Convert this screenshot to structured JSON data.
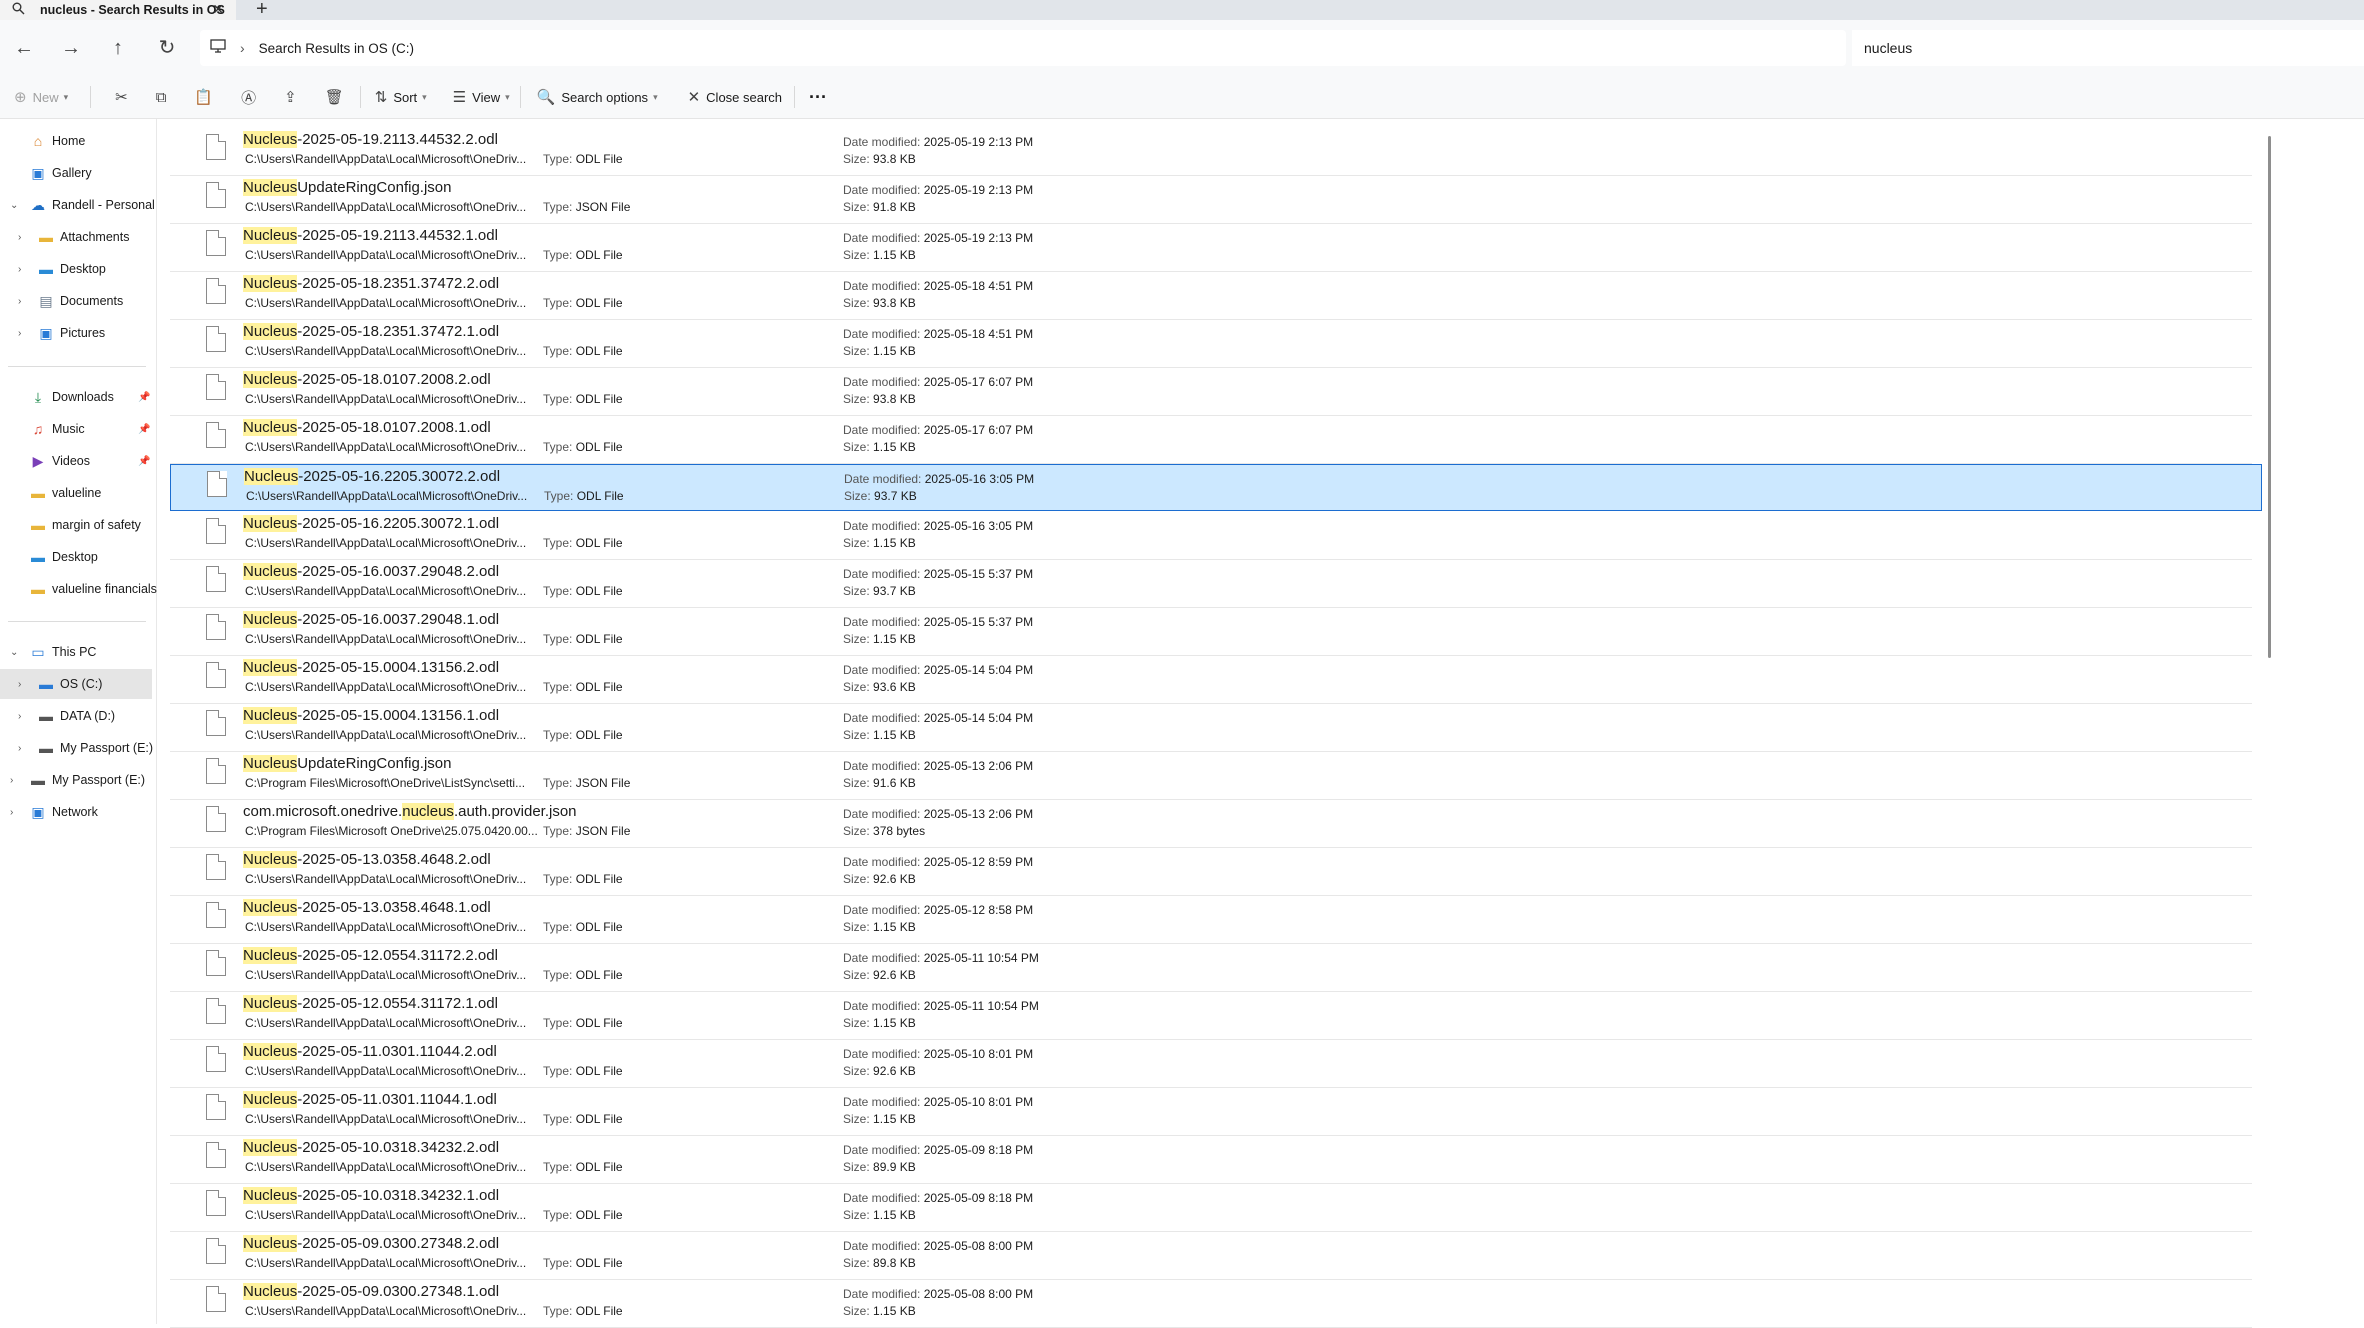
{
  "tab": {
    "title": "nucleus - Search Results in OS",
    "close": "✕",
    "new": "+"
  },
  "address": {
    "path": "Search Results in OS (C:)"
  },
  "search": {
    "value": "nucleus"
  },
  "commands": {
    "new": "New",
    "sort": "Sort",
    "view": "View",
    "search_options": "Search options",
    "close_search": "Close search",
    "more": "···"
  },
  "sidebar": {
    "items": [
      {
        "label": "Home"
      },
      {
        "label": "Gallery"
      },
      {
        "label": "Randell - Personal"
      },
      {
        "label": "Attachments"
      },
      {
        "label": "Desktop"
      },
      {
        "label": "Documents"
      },
      {
        "label": "Pictures"
      },
      {
        "label": "Downloads"
      },
      {
        "label": "Music"
      },
      {
        "label": "Videos"
      },
      {
        "label": "valueline"
      },
      {
        "label": "margin of safety"
      },
      {
        "label": "Desktop"
      },
      {
        "label": "valueline financials"
      },
      {
        "label": "This PC"
      },
      {
        "label": "OS (C:)"
      },
      {
        "label": "DATA (D:)"
      },
      {
        "label": "My Passport (E:)"
      },
      {
        "label": "My Passport (E:)"
      },
      {
        "label": "Network"
      }
    ]
  },
  "labels": {
    "type": "Type:",
    "date": "Date modified:",
    "size": "Size:"
  },
  "files": [
    {
      "pre": "",
      "hl": "Nucleus",
      "post": "-2025-05-19.2113.44532.2.odl",
      "path": "C:\\Users\\Randell\\AppData\\Local\\Microsoft\\OneDriv...",
      "type": "ODL File",
      "date": "2025-05-19 2:13 PM",
      "size": "93.8 KB"
    },
    {
      "pre": "",
      "hl": "Nucleus",
      "post": "UpdateRingConfig.json",
      "path": "C:\\Users\\Randell\\AppData\\Local\\Microsoft\\OneDriv...",
      "type": "JSON File",
      "date": "2025-05-19 2:13 PM",
      "size": "91.8 KB"
    },
    {
      "pre": "",
      "hl": "Nucleus",
      "post": "-2025-05-19.2113.44532.1.odl",
      "path": "C:\\Users\\Randell\\AppData\\Local\\Microsoft\\OneDriv...",
      "type": "ODL File",
      "date": "2025-05-19 2:13 PM",
      "size": "1.15 KB"
    },
    {
      "pre": "",
      "hl": "Nucleus",
      "post": "-2025-05-18.2351.37472.2.odl",
      "path": "C:\\Users\\Randell\\AppData\\Local\\Microsoft\\OneDriv...",
      "type": "ODL File",
      "date": "2025-05-18 4:51 PM",
      "size": "93.8 KB"
    },
    {
      "pre": "",
      "hl": "Nucleus",
      "post": "-2025-05-18.2351.37472.1.odl",
      "path": "C:\\Users\\Randell\\AppData\\Local\\Microsoft\\OneDriv...",
      "type": "ODL File",
      "date": "2025-05-18 4:51 PM",
      "size": "1.15 KB"
    },
    {
      "pre": "",
      "hl": "Nucleus",
      "post": "-2025-05-18.0107.2008.2.odl",
      "path": "C:\\Users\\Randell\\AppData\\Local\\Microsoft\\OneDriv...",
      "type": "ODL File",
      "date": "2025-05-17 6:07 PM",
      "size": "93.8 KB"
    },
    {
      "pre": "",
      "hl": "Nucleus",
      "post": "-2025-05-18.0107.2008.1.odl",
      "path": "C:\\Users\\Randell\\AppData\\Local\\Microsoft\\OneDriv...",
      "type": "ODL File",
      "date": "2025-05-17 6:07 PM",
      "size": "1.15 KB"
    },
    {
      "pre": "",
      "hl": "Nucleus",
      "post": "-2025-05-16.2205.30072.2.odl",
      "path": "C:\\Users\\Randell\\AppData\\Local\\Microsoft\\OneDriv...",
      "type": "ODL File",
      "date": "2025-05-16 3:05 PM",
      "size": "93.7 KB",
      "selected": true
    },
    {
      "pre": "",
      "hl": "Nucleus",
      "post": "-2025-05-16.2205.30072.1.odl",
      "path": "C:\\Users\\Randell\\AppData\\Local\\Microsoft\\OneDriv...",
      "type": "ODL File",
      "date": "2025-05-16 3:05 PM",
      "size": "1.15 KB"
    },
    {
      "pre": "",
      "hl": "Nucleus",
      "post": "-2025-05-16.0037.29048.2.odl",
      "path": "C:\\Users\\Randell\\AppData\\Local\\Microsoft\\OneDriv...",
      "type": "ODL File",
      "date": "2025-05-15 5:37 PM",
      "size": "93.7 KB"
    },
    {
      "pre": "",
      "hl": "Nucleus",
      "post": "-2025-05-16.0037.29048.1.odl",
      "path": "C:\\Users\\Randell\\AppData\\Local\\Microsoft\\OneDriv...",
      "type": "ODL File",
      "date": "2025-05-15 5:37 PM",
      "size": "1.15 KB"
    },
    {
      "pre": "",
      "hl": "Nucleus",
      "post": "-2025-05-15.0004.13156.2.odl",
      "path": "C:\\Users\\Randell\\AppData\\Local\\Microsoft\\OneDriv...",
      "type": "ODL File",
      "date": "2025-05-14 5:04 PM",
      "size": "93.6 KB"
    },
    {
      "pre": "",
      "hl": "Nucleus",
      "post": "-2025-05-15.0004.13156.1.odl",
      "path": "C:\\Users\\Randell\\AppData\\Local\\Microsoft\\OneDriv...",
      "type": "ODL File",
      "date": "2025-05-14 5:04 PM",
      "size": "1.15 KB"
    },
    {
      "pre": "",
      "hl": "Nucleus",
      "post": "UpdateRingConfig.json",
      "path": "C:\\Program Files\\Microsoft\\OneDrive\\ListSync\\setti...",
      "type": "JSON File",
      "date": "2025-05-13 2:06 PM",
      "size": "91.6 KB"
    },
    {
      "pre": "com.microsoft.onedrive.",
      "hl": "nucleus",
      "post": ".auth.provider.json",
      "path": "C:\\Program Files\\Microsoft OneDrive\\25.075.0420.00...",
      "type": "JSON File",
      "date": "2025-05-13 2:06 PM",
      "size": "378 bytes"
    },
    {
      "pre": "",
      "hl": "Nucleus",
      "post": "-2025-05-13.0358.4648.2.odl",
      "path": "C:\\Users\\Randell\\AppData\\Local\\Microsoft\\OneDriv...",
      "type": "ODL File",
      "date": "2025-05-12 8:59 PM",
      "size": "92.6 KB"
    },
    {
      "pre": "",
      "hl": "Nucleus",
      "post": "-2025-05-13.0358.4648.1.odl",
      "path": "C:\\Users\\Randell\\AppData\\Local\\Microsoft\\OneDriv...",
      "type": "ODL File",
      "date": "2025-05-12 8:58 PM",
      "size": "1.15 KB"
    },
    {
      "pre": "",
      "hl": "Nucleus",
      "post": "-2025-05-12.0554.31172.2.odl",
      "path": "C:\\Users\\Randell\\AppData\\Local\\Microsoft\\OneDriv...",
      "type": "ODL File",
      "date": "2025-05-11 10:54 PM",
      "size": "92.6 KB"
    },
    {
      "pre": "",
      "hl": "Nucleus",
      "post": "-2025-05-12.0554.31172.1.odl",
      "path": "C:\\Users\\Randell\\AppData\\Local\\Microsoft\\OneDriv...",
      "type": "ODL File",
      "date": "2025-05-11 10:54 PM",
      "size": "1.15 KB"
    },
    {
      "pre": "",
      "hl": "Nucleus",
      "post": "-2025-05-11.0301.11044.2.odl",
      "path": "C:\\Users\\Randell\\AppData\\Local\\Microsoft\\OneDriv...",
      "type": "ODL File",
      "date": "2025-05-10 8:01 PM",
      "size": "92.6 KB"
    },
    {
      "pre": "",
      "hl": "Nucleus",
      "post": "-2025-05-11.0301.11044.1.odl",
      "path": "C:\\Users\\Randell\\AppData\\Local\\Microsoft\\OneDriv...",
      "type": "ODL File",
      "date": "2025-05-10 8:01 PM",
      "size": "1.15 KB"
    },
    {
      "pre": "",
      "hl": "Nucleus",
      "post": "-2025-05-10.0318.34232.2.odl",
      "path": "C:\\Users\\Randell\\AppData\\Local\\Microsoft\\OneDriv...",
      "type": "ODL File",
      "date": "2025-05-09 8:18 PM",
      "size": "89.9 KB"
    },
    {
      "pre": "",
      "hl": "Nucleus",
      "post": "-2025-05-10.0318.34232.1.odl",
      "path": "C:\\Users\\Randell\\AppData\\Local\\Microsoft\\OneDriv...",
      "type": "ODL File",
      "date": "2025-05-09 8:18 PM",
      "size": "1.15 KB"
    },
    {
      "pre": "",
      "hl": "Nucleus",
      "post": "-2025-05-09.0300.27348.2.odl",
      "path": "C:\\Users\\Randell\\AppData\\Local\\Microsoft\\OneDriv...",
      "type": "ODL File",
      "date": "2025-05-08 8:00 PM",
      "size": "89.8 KB"
    },
    {
      "pre": "",
      "hl": "Nucleus",
      "post": "-2025-05-09.0300.27348.1.odl",
      "path": "C:\\Users\\Randell\\AppData\\Local\\Microsoft\\OneDriv...",
      "type": "ODL File",
      "date": "2025-05-08 8:00 PM",
      "size": "1.15 KB"
    }
  ]
}
